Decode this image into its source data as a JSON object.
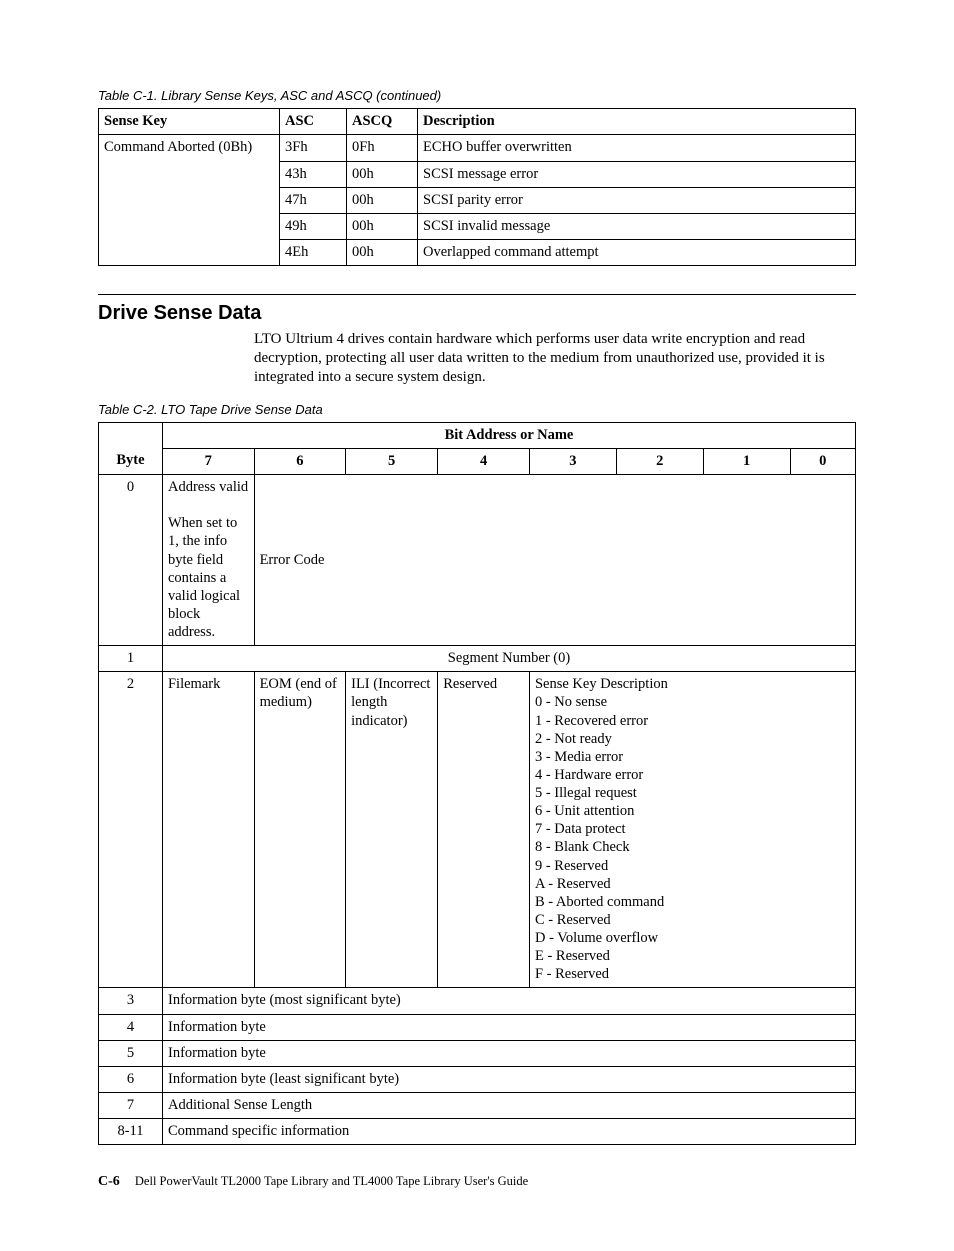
{
  "table1": {
    "caption": "Table C-1. Library Sense Keys, ASC and ASCQ  (continued)",
    "headers": {
      "c0": "Sense Key",
      "c1": "ASC",
      "c2": "ASCQ",
      "c3": "Description"
    },
    "group_label": "Command Aborted (0Bh)",
    "rows": [
      {
        "asc": "3Fh",
        "ascq": "0Fh",
        "desc": "ECHO buffer overwritten"
      },
      {
        "asc": "43h",
        "ascq": "00h",
        "desc": "SCSI message error"
      },
      {
        "asc": "47h",
        "ascq": "00h",
        "desc": "SCSI parity error"
      },
      {
        "asc": "49h",
        "ascq": "00h",
        "desc": "SCSI invalid message"
      },
      {
        "asc": "4Eh",
        "ascq": "00h",
        "desc": "Overlapped command attempt"
      }
    ]
  },
  "section": {
    "heading": "Drive Sense Data",
    "para": "LTO Ultrium 4 drives contain hardware which performs user data write encryption and read decryption, protecting all user data written to the medium from unauthorized use, provided it is integrated into a secure system design."
  },
  "table2": {
    "caption": "Table C-2. LTO Tape Drive Sense Data",
    "top_header": "Bit Address or Name",
    "col_headers": {
      "byte": "Byte",
      "b7": "7",
      "b6": "6",
      "b5": "5",
      "b4": "4",
      "b3": "3",
      "b2": "2",
      "b1": "1",
      "b0": "0"
    },
    "row0": {
      "byte": "0",
      "bit7": "Address valid\n\nWhen set to 1, the info byte field contains a valid logical block address.",
      "rest": "Error Code"
    },
    "row1": {
      "byte": "1",
      "span": "Segment Number (0)",
      "align": "center"
    },
    "row2": {
      "byte": "2",
      "b7": "Filemark",
      "b6": "EOM (end of medium)",
      "b5": "ILI (Incorrect length indicator)",
      "b4": "Reserved",
      "sk": "Sense Key Description\n0  -  No  sense\n1  -  Recovered  error\n2  -  Not  ready\n3  -  Media  error\n4  -  Hardware  error\n5  -  Illegal  request\n6  -  Unit  attention\n7  -  Data  protect\n8  -  Blank  Check\n9  -  Reserved\nA  -  Reserved\nB  -  Aborted  command\nC  -  Reserved\nD  -  Volume  overflow\nE  -  Reserved\nF  -  Reserved"
    },
    "row3": {
      "byte": "3",
      "span": "Information byte (most significant byte)"
    },
    "row4": {
      "byte": "4",
      "span": "Information byte"
    },
    "row5": {
      "byte": "5",
      "span": "Information byte"
    },
    "row6": {
      "byte": "6",
      "span": "Information byte (least significant byte)"
    },
    "row7": {
      "byte": "7",
      "span": "Additional Sense Length"
    },
    "row8": {
      "byte": "8-11",
      "span": "Command specific information"
    }
  },
  "footer": {
    "page": "C-6",
    "title": "Dell PowerVault TL2000 Tape Library and TL4000 Tape Library User's Guide"
  }
}
